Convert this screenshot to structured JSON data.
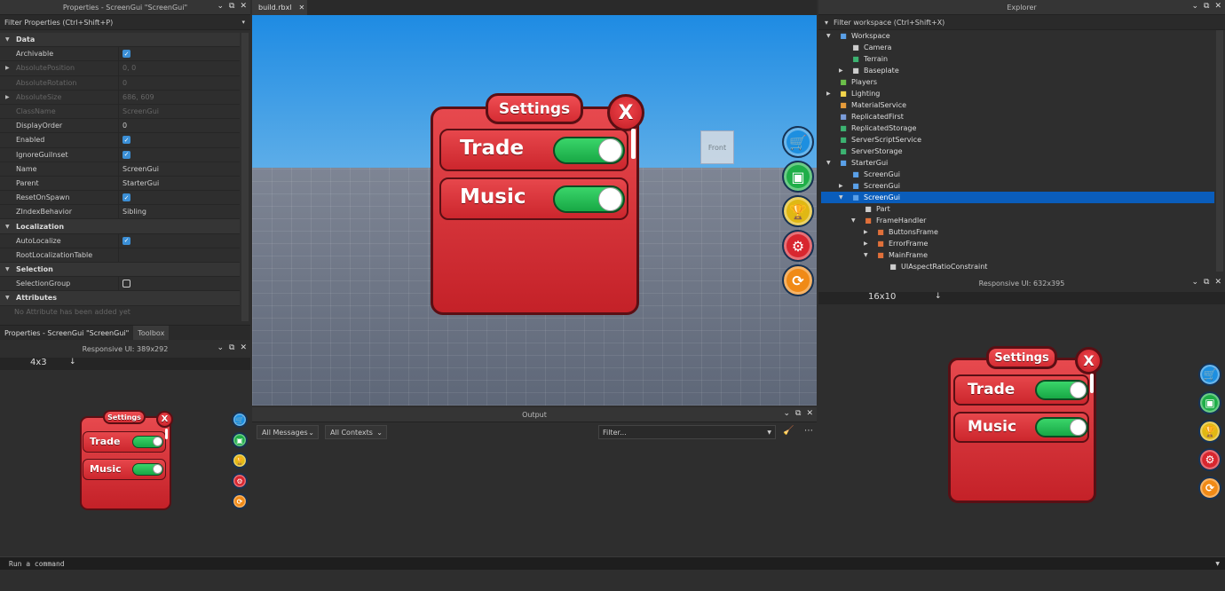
{
  "properties": {
    "title": "Properties - ScreenGui \"ScreenGui\"",
    "filter": "Filter Properties (Ctrl+Shift+P)",
    "rows": [
      {
        "type": "cat",
        "name": "Data"
      },
      {
        "name": "Archivable",
        "check": true
      },
      {
        "name": "AbsolutePosition",
        "value": "0, 0",
        "dim": true,
        "exp": true
      },
      {
        "name": "AbsoluteRotation",
        "value": "0",
        "dim": true
      },
      {
        "name": "AbsoluteSize",
        "value": "686, 609",
        "dim": true,
        "exp": true
      },
      {
        "name": "ClassName",
        "value": "ScreenGui",
        "dim": true
      },
      {
        "name": "DisplayOrder",
        "value": "0"
      },
      {
        "name": "Enabled",
        "check": true
      },
      {
        "name": "IgnoreGuiInset",
        "check": true
      },
      {
        "name": "Name",
        "value": "ScreenGui"
      },
      {
        "name": "Parent",
        "value": "StarterGui"
      },
      {
        "name": "ResetOnSpawn",
        "check": true
      },
      {
        "name": "ZIndexBehavior",
        "value": "Sibling"
      },
      {
        "type": "cat",
        "name": "Localization"
      },
      {
        "name": "AutoLocalize",
        "check": true
      },
      {
        "name": "RootLocalizationTable",
        "value": ""
      },
      {
        "type": "cat",
        "name": "Selection"
      },
      {
        "name": "SelectionGroup",
        "check": false
      },
      {
        "type": "cat",
        "name": "Attributes"
      }
    ],
    "no_attr": "No Attribute has been added yet",
    "tabs": [
      "Properties - ScreenGui \"ScreenGui\"",
      "Toolbox"
    ]
  },
  "viewport": {
    "tab": "build.rbxl",
    "front_label": "Front"
  },
  "game": {
    "title": "Settings",
    "close": "X",
    "trade": "Trade",
    "music": "Music"
  },
  "responsive_left": {
    "title": "Responsive UI: 389x292",
    "ratio": "4x3",
    "arrow": "↓"
  },
  "responsive_right": {
    "title": "Responsive UI: 632x395",
    "ratio": "16x10",
    "arrow": "↓"
  },
  "output": {
    "title": "Output",
    "messages": "All Messages",
    "contexts": "All Contexts",
    "filter": "Filter..."
  },
  "explorer": {
    "title": "Explorer",
    "filter": "Filter workspace (Ctrl+Shift+X)",
    "items": [
      {
        "label": "Workspace",
        "depth": 0,
        "arrow": "down",
        "icon": "globe-icon",
        "color": "#5aa0e8"
      },
      {
        "label": "Camera",
        "depth": 1,
        "icon": "camera-icon",
        "color": "#ccc"
      },
      {
        "label": "Terrain",
        "depth": 1,
        "icon": "terrain-icon",
        "color": "#3cb371"
      },
      {
        "label": "Baseplate",
        "depth": 1,
        "arrow": "right",
        "icon": "part-icon",
        "color": "#ccc"
      },
      {
        "label": "Players",
        "depth": 0,
        "icon": "players-icon",
        "color": "#6cc04a"
      },
      {
        "label": "Lighting",
        "depth": 0,
        "arrow": "right",
        "icon": "lighting-icon",
        "color": "#f2d44b"
      },
      {
        "label": "MaterialService",
        "depth": 0,
        "icon": "material-icon",
        "color": "#e69b3a"
      },
      {
        "label": "ReplicatedFirst",
        "depth": 0,
        "icon": "replicated-icon",
        "color": "#7a9cd9"
      },
      {
        "label": "ReplicatedStorage",
        "depth": 0,
        "icon": "storage-icon",
        "color": "#3cb371"
      },
      {
        "label": "ServerScriptService",
        "depth": 0,
        "icon": "script-service-icon",
        "color": "#3cb371"
      },
      {
        "label": "ServerStorage",
        "depth": 0,
        "icon": "server-storage-icon",
        "color": "#3cb371"
      },
      {
        "label": "StarterGui",
        "depth": 0,
        "arrow": "down",
        "icon": "starter-gui-icon",
        "color": "#5aa0e8"
      },
      {
        "label": "ScreenGui",
        "depth": 1,
        "icon": "screengui-icon",
        "color": "#5aa0e8"
      },
      {
        "label": "ScreenGui",
        "depth": 1,
        "arrow": "right",
        "icon": "screengui-icon",
        "color": "#5aa0e8"
      },
      {
        "label": "ScreenGui",
        "depth": 1,
        "arrow": "down",
        "icon": "screengui-icon",
        "color": "#5aa0e8",
        "selected": true
      },
      {
        "label": "Part",
        "depth": 2,
        "icon": "part-icon",
        "color": "#ccc"
      },
      {
        "label": "FrameHandler",
        "depth": 2,
        "arrow": "down",
        "icon": "frame-icon",
        "color": "#e0703a"
      },
      {
        "label": "ButtonsFrame",
        "depth": 3,
        "arrow": "right",
        "icon": "frame-icon",
        "color": "#e0703a"
      },
      {
        "label": "ErrorFrame",
        "depth": 3,
        "arrow": "right",
        "icon": "frame-icon",
        "color": "#e0703a"
      },
      {
        "label": "MainFrame",
        "depth": 3,
        "arrow": "down",
        "icon": "frame-icon",
        "color": "#e0703a"
      },
      {
        "label": "UIAspectRatioConstraint",
        "depth": 4,
        "icon": "constraint-icon",
        "color": "#ccc"
      }
    ]
  },
  "command": {
    "placeholder": "Run a command"
  },
  "side_buttons": [
    {
      "name": "shop-button",
      "icon": "cart-icon",
      "glyph": "🛒",
      "color": "#1d8fe0"
    },
    {
      "name": "inventory-button",
      "icon": "backpack-icon",
      "glyph": "▣",
      "color": "#1fae48"
    },
    {
      "name": "trophy-button",
      "icon": "trophy-icon",
      "glyph": "🏆",
      "color": "#e0b814"
    },
    {
      "name": "settings-button",
      "icon": "gear-icon",
      "glyph": "⚙",
      "color": "#d8262f"
    },
    {
      "name": "refresh-button",
      "icon": "refresh-icon",
      "glyph": "⟳",
      "color": "#f08a16"
    }
  ]
}
